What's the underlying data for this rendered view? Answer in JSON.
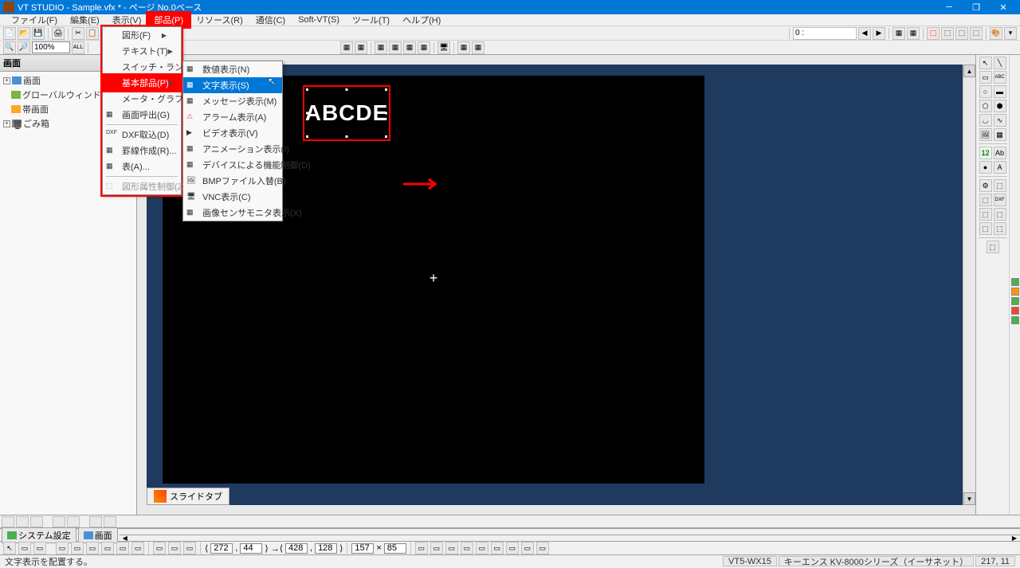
{
  "title": "VT STUDIO - Sample.vfx * - ページ No.0ベース",
  "menubar": {
    "file": "ファイル(F)",
    "edit": "編集(E)",
    "view": "表示(V)",
    "parts": "部品(P)",
    "resource": "リソース(R)",
    "comm": "通信(C)",
    "softvt": "Soft-VT(S)",
    "tool": "ツール(T)",
    "help": "ヘルプ(H)"
  },
  "zoom": "100%",
  "toolbar_dropdown": "0 :",
  "left_panel": {
    "header": "画面",
    "nodes": {
      "screen": "画面",
      "global": "グローバルウィンドウ",
      "strip": "帯画面",
      "trash": "ごみ箱"
    }
  },
  "menu1": {
    "figure": "図形(F)",
    "text": "テキスト(T)",
    "switch": "スイッチ・ランプ(S)",
    "basic": "基本部品(P)",
    "meter": "メータ・グラフ(M)",
    "screen": "画面呼出(G)",
    "dxf": "DXF取込(D)",
    "strip": "罫線作成(R)...",
    "table": "表(A)...",
    "shapeattr": "図形属性制御(Z)..."
  },
  "menu2": {
    "numeric": "数値表示(N)",
    "textdisp": "文字表示(S)",
    "message": "メッセージ表示(M)",
    "alarm": "アラーム表示(A)",
    "video": "ビデオ表示(V)",
    "anim": "アニメーション表示(I)",
    "device": "デバイスによる機能制御(D)",
    "bmp": "BMPファイル入替(B)",
    "vnc": "VNC表示(C)",
    "imgsensor": "画像センサモニタ表示(X)"
  },
  "canvas": {
    "text_widget": "ABCDE",
    "slide_tab": "スライドタブ"
  },
  "bottom_tabs": {
    "system": "システム設定",
    "screen": "画面"
  },
  "status_toolbar": {
    "x": "272",
    "y": "44",
    "w": "428",
    "h": "128",
    "cx": "157",
    "cy": "85"
  },
  "statusbar": {
    "msg": "文字表示を配置する。",
    "model": "VT5-WX15",
    "plc": "キーエンス KV-8000シリーズ（イーサネット）",
    "pos": "217, 11"
  }
}
